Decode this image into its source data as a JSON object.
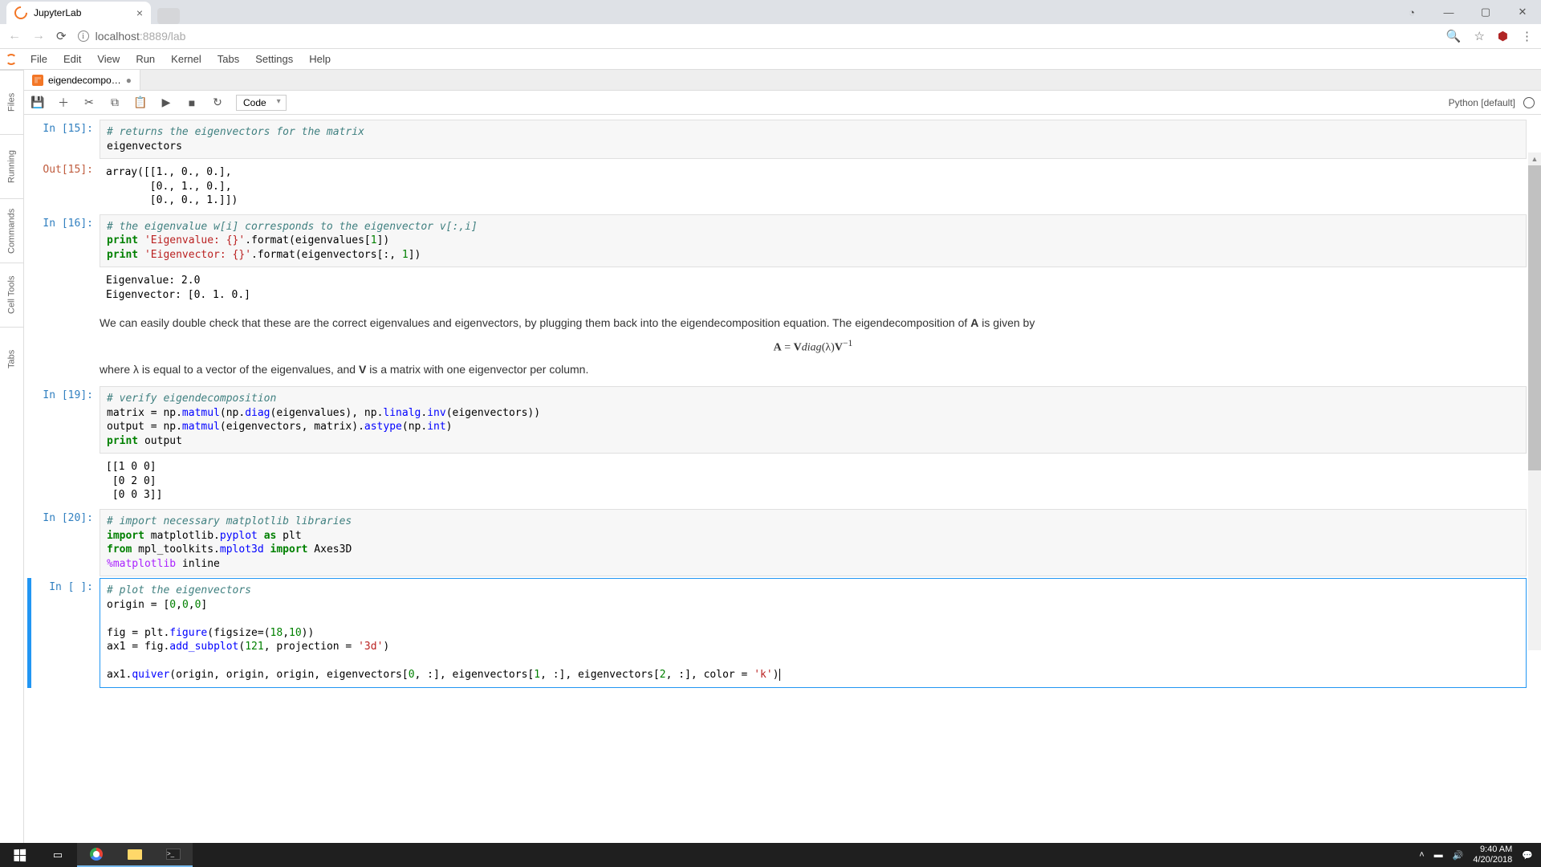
{
  "browser": {
    "tab_title": "JupyterLab",
    "url": "localhost:8889/lab",
    "url_prefix": "localhost",
    "url_suffix": ":8889/lab"
  },
  "menubar": [
    "File",
    "Edit",
    "View",
    "Run",
    "Kernel",
    "Tabs",
    "Settings",
    "Help"
  ],
  "left_rail": [
    "Files",
    "Running",
    "Commands",
    "Cell Tools",
    "Tabs"
  ],
  "doc_tab": {
    "name": "eigendecompo…"
  },
  "toolbar": {
    "cell_type": "Code",
    "kernel": "Python [default]"
  },
  "cells": {
    "c15_prompt": "In [15]:",
    "c15_code_l1": "# returns the eigenvectors for the matrix",
    "c15_code_l2": "eigenvectors",
    "c15_out_prompt": "Out[15]:",
    "c15_out": "array([[1., 0., 0.],\n       [0., 1., 0.],\n       [0., 0., 1.]])",
    "c16_prompt": "In [16]:",
    "c16_code_html": "<span class='cm'># the eigenvalue w[i] corresponds to the eigenvector v[:,i]</span>\n<span class='kw'>print</span> <span class='str'>'Eigenvalue: {}'</span>.format(eigenvalues[<span class='num'>1</span>])\n<span class='kw'>print</span> <span class='str'>'Eigenvector: {}'</span>.format(eigenvectors[:, <span class='num'>1</span>])",
    "c16_out": "Eigenvalue: 2.0\nEigenvector: [0. 1. 0.]",
    "md_text_1": "We can easily double check that these are the correct eigenvalues and eigenvectors, by plugging them back into the eigendecomposition equation. The eigendecomposition of ",
    "md_A": "A",
    "md_text_2": " is given by",
    "md_eq": "A = V𝑑𝑖𝑎𝑔(λ)V⁻¹",
    "md_text_3": "where λ is equal to a vector of the eigenvalues, and ",
    "md_V": "V",
    "md_text_4": " is a matrix with one eigenvector per column.",
    "c19_prompt": "In [19]:",
    "c19_code_html": "<span class='cm'># verify eigendecomposition</span>\nmatrix = np.<span class='nm'>matmul</span>(np.<span class='nm'>diag</span>(eigenvalues), np.<span class='nm'>linalg</span>.<span class='nm'>inv</span>(eigenvectors))\noutput = np.<span class='nm'>matmul</span>(eigenvectors, matrix).<span class='nm'>astype</span>(np.<span class='nm'>int</span>)\n<span class='kw'>print</span> output",
    "c19_out": "[[1 0 0]\n [0 2 0]\n [0 0 3]]",
    "c20_prompt": "In [20]:",
    "c20_code_html": "<span class='cm'># import necessary matplotlib libraries</span>\n<span class='kw'>import</span> matplotlib.<span class='nm'>pyplot</span> <span class='kw'>as</span> plt\n<span class='kw'>from</span> mpl_toolkits.<span class='nm'>mplot3d</span> <span class='kw'>import</span> Axes3D\n<span class='mag'>%matplotlib</span> inline",
    "cE_prompt": "In [ ]:",
    "cE_code_html": "<span class='cm'># plot the eigenvectors</span>\norigin = [<span class='num'>0</span>,<span class='num'>0</span>,<span class='num'>0</span>]\n\nfig = plt.<span class='nm'>figure</span>(figsize=(<span class='num'>18</span>,<span class='num'>10</span>))\nax1 = fig.<span class='nm'>add_subplot</span>(<span class='num'>121</span>, projection = <span class='str'>'3d'</span>)\n\nax1.<span class='nm'>quiver</span>(origin, origin, origin, eigenvectors[<span class='num'>0</span>, :], eigenvectors[<span class='num'>1</span>, :], eigenvectors[<span class='num'>2</span>, :], color = <span class='str'>'k'</span>)<span class='cursor'></span>"
  },
  "taskbar": {
    "time": "9:40 AM",
    "date": "4/20/2018"
  }
}
